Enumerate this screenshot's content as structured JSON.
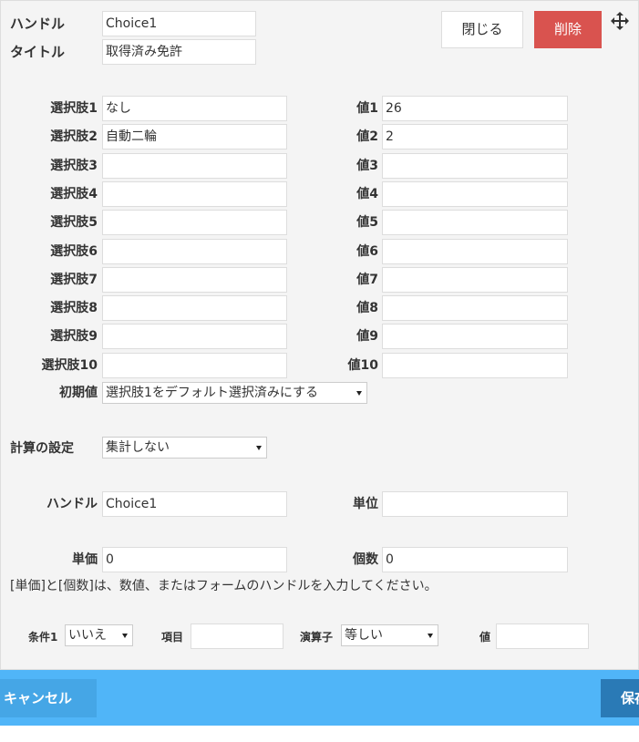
{
  "header": {
    "handle_label": "ハンドル",
    "handle_value": "Choice1",
    "title_label": "タイトル",
    "title_value": "取得済み免許",
    "close_label": "閉じる",
    "delete_label": "削除",
    "move_icon": "move-icon"
  },
  "choices": [
    {
      "label": "選択肢1",
      "value": "なし",
      "vlabel": "値1",
      "vvalue": "26"
    },
    {
      "label": "選択肢2",
      "value": "自動二輪",
      "vlabel": "値2",
      "vvalue": "2"
    },
    {
      "label": "選択肢3",
      "value": "",
      "vlabel": "値3",
      "vvalue": ""
    },
    {
      "label": "選択肢4",
      "value": "",
      "vlabel": "値4",
      "vvalue": ""
    },
    {
      "label": "選択肢5",
      "value": "",
      "vlabel": "値5",
      "vvalue": ""
    },
    {
      "label": "選択肢6",
      "value": "",
      "vlabel": "値6",
      "vvalue": ""
    },
    {
      "label": "選択肢7",
      "value": "",
      "vlabel": "値7",
      "vvalue": ""
    },
    {
      "label": "選択肢8",
      "value": "",
      "vlabel": "値8",
      "vvalue": ""
    },
    {
      "label": "選択肢9",
      "value": "",
      "vlabel": "値9",
      "vvalue": ""
    },
    {
      "label": "選択肢10",
      "value": "",
      "vlabel": "値10",
      "vvalue": ""
    }
  ],
  "default": {
    "label": "初期値",
    "value": "選択肢1をデフォルト選択済みにする"
  },
  "calc": {
    "label": "計算の設定",
    "value": "集計しない",
    "handle_label": "ハンドル",
    "handle_value": "Choice1",
    "unit_label": "単位",
    "unit_value": "",
    "price_label": "単価",
    "price_value": "0",
    "count_label": "個数",
    "count_value": "0",
    "note": "[単価]と[個数]は、数値、またはフォームのハンドルを入力してください。"
  },
  "condition": {
    "label": "条件1",
    "value": "いいえ",
    "item_label": "項目",
    "item_value": "",
    "op_label": "演算子",
    "op_value": "等しい",
    "val_label": "値",
    "val_value": ""
  },
  "footer": {
    "cancel_label": "キャンセル",
    "save_label": "保存"
  }
}
